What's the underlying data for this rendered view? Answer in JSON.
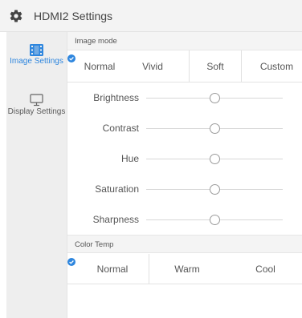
{
  "window": {
    "title": "HDMI2 Settings",
    "icon": "gear-icon"
  },
  "sidebar": {
    "items": [
      {
        "label": "Image Settings",
        "icon": "image-settings-icon",
        "active": true
      },
      {
        "label": "Display Settings",
        "icon": "monitor-icon",
        "active": false
      }
    ]
  },
  "image_mode": {
    "header": "Image mode",
    "options": [
      "Normal",
      "Vivid",
      "Soft",
      "Custom"
    ],
    "selected": "Normal"
  },
  "sliders": [
    {
      "label": "Brightness",
      "value": 0.5
    },
    {
      "label": "Contrast",
      "value": 0.5
    },
    {
      "label": "Hue",
      "value": 0.5
    },
    {
      "label": "Saturation",
      "value": 0.5
    },
    {
      "label": "Sharpness",
      "value": 0.5
    }
  ],
  "color_temp": {
    "header": "Color Temp",
    "options": [
      "Normal",
      "Warm",
      "Cool"
    ],
    "selected": "Normal"
  },
  "colors": {
    "accent": "#2e86de",
    "sidebar_bg": "#eeeeee",
    "header_bg": "#f3f3f3"
  }
}
